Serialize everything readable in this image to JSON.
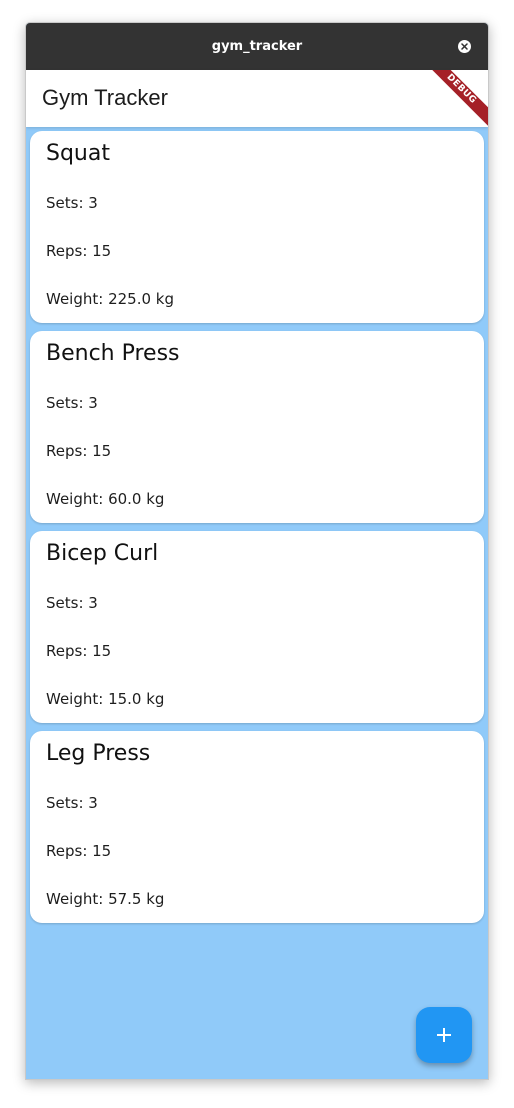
{
  "window": {
    "title": "gym_tracker"
  },
  "appbar": {
    "title": "Gym Tracker",
    "debug_banner": "DEBUG"
  },
  "exercises": [
    {
      "name": "Squat",
      "sets": "Sets: 3",
      "reps": "Reps: 15",
      "weight": "Weight: 225.0 kg"
    },
    {
      "name": "Bench Press",
      "sets": "Sets: 3",
      "reps": "Reps: 15",
      "weight": "Weight: 60.0 kg"
    },
    {
      "name": "Bicep Curl",
      "sets": "Sets: 3",
      "reps": "Reps: 15",
      "weight": "Weight: 15.0 kg"
    },
    {
      "name": "Leg Press",
      "sets": "Sets: 3",
      "reps": "Reps: 15",
      "weight": "Weight: 57.5 kg"
    }
  ],
  "fab": {
    "icon": "plus-icon"
  },
  "colors": {
    "titlebar": "#333333",
    "background": "#90caf9",
    "card": "#ffffff",
    "fab": "#2196f3",
    "debug_ribbon": "#a52027"
  }
}
